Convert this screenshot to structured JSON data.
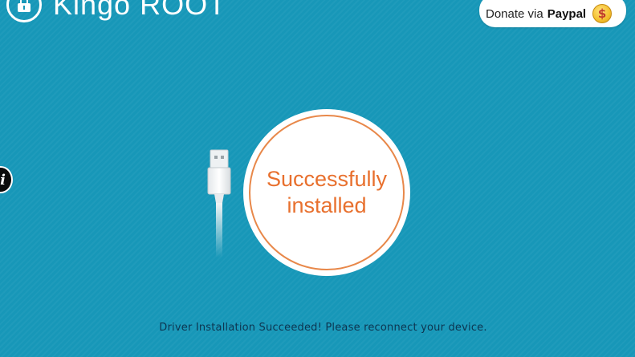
{
  "app": {
    "logo_text": "Kingo ROOT"
  },
  "header": {
    "donate_prefix": "Donate via",
    "donate_brand": "Paypal",
    "donate_coin_symbol": "$"
  },
  "sidebar": {
    "info_glyph": "i"
  },
  "status": {
    "line1": "Successfully",
    "line2": "installed",
    "message": "Driver Installation Succeeded! Please reconnect your device."
  },
  "icons": {
    "logo": "lock-icon",
    "donate": "dollar-coin-icon",
    "info": "info-icon",
    "device": "usb-cable-icon"
  },
  "colors": {
    "background": "#1797b8",
    "accent": "#e8702e",
    "ring": "#e8884a",
    "panel": "#ffffff"
  }
}
